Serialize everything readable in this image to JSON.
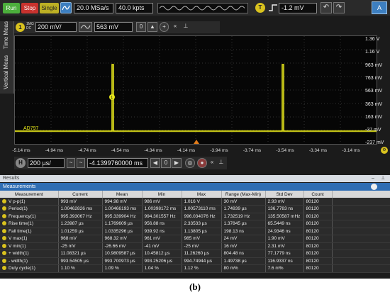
{
  "toolbar": {
    "run_label": "Run",
    "stop_label": "Stop",
    "single_label": "Single",
    "sample_rate": "20.0 MSa/s",
    "memory_depth": "40.0 kpts",
    "trigger_badge": "T",
    "trigger_level": "-1.2 mV",
    "undo_label": "↶",
    "redo_label": "↷",
    "autoscale_label": "A"
  },
  "side_tabs": {
    "time_meas": "Time Meas",
    "vertical_meas": "Vertical Meas"
  },
  "channel": {
    "badge": "1",
    "coupling_top": "1MΩ",
    "coupling_bottom": "DC",
    "scale": "200 mV/",
    "offset": "563 mV"
  },
  "waveform": {
    "marker_label": "AD797",
    "marker_badge": "1",
    "volt_labels": [
      "1.36 V",
      "1.16 V",
      "963 mV",
      "763 mV",
      "563 mV",
      "363 mV",
      "163 mV",
      "-37 mV",
      "-237 mV"
    ],
    "time_labels": [
      "-5.14 ms",
      "-4.94 ms",
      "-4.74 ms",
      "-4.54 ms",
      "-4.34 ms",
      "-4.14 ms",
      "-3.94 ms",
      "-3.74 ms",
      "-3.54 ms",
      "-3.34 ms",
      "-3.14 ms"
    ],
    "trace_color": "#e5e51a"
  },
  "horizontal": {
    "badge": "H",
    "time_scale": "200 µs/",
    "delay": "-4.1399760000 ms"
  },
  "results": {
    "title": "Results",
    "measurements_title": "Measurements",
    "columns": [
      "Measurement",
      "Current",
      "Mean",
      "Min",
      "Max",
      "Range (Max-Min)",
      "Std Dev",
      "Count"
    ],
    "rows": [
      [
        "V p-p(1)",
        "993 mV",
        "994.98 mV",
        "986 mV",
        "1.016 V",
        "30 mV",
        "2.93 mV",
        "80120"
      ],
      [
        "Period(1)",
        "1.00462826 ms",
        "1.00466193 ms",
        "1.00398172 ms",
        "1.00573110 ms",
        "1.74939 µs",
        "136.7783 ns",
        "80120"
      ],
      [
        "Frequency(1)",
        "995.393067 Hz",
        "995.339904 Hz",
        "994.301557 Hz",
        "996.034076 Hz",
        "1.732519 Hz",
        "135.50587 mHz",
        "80120"
      ],
      [
        "Rise time(1)",
        "1.23987 µs",
        "1.1769609 µs",
        "956.88 ns",
        "2.33533 µs",
        "1.37845 µs",
        "65.5449 ns",
        "80120"
      ],
      [
        "Fall time(1)",
        "1.01259 µs",
        "1.0335296 µs",
        "939.92 ns",
        "1.13805 µs",
        "198.13 ns",
        "24.9346 ns",
        "80120"
      ],
      [
        "V max(1)",
        "968 mV",
        "968.32 mV",
        "961 mV",
        "985 mV",
        "24 mV",
        "1.90 mV",
        "80120"
      ],
      [
        "V min(1)",
        "-25 mV",
        "-26.66 mV",
        "-41 mV",
        "-25 mV",
        "16 mV",
        "2.31 mV",
        "80120"
      ],
      [
        "+ width(1)",
        "11.08321 µs",
        "10.9809587 µs",
        "10.45812 µs",
        "11.26260 µs",
        "804.48 ns",
        "77.1779 ns",
        "80120"
      ],
      [
        "- width(1)",
        "993.54505 µs",
        "993.700973 µs",
        "993.25206 µs",
        "994.74944 µs",
        "1.49738 µs",
        "116.9337 ns",
        "80120"
      ],
      [
        "Duty cycle(1)",
        "1.10 %",
        "1.09 %",
        "1.04 %",
        "1.12 %",
        "80 m%",
        "7.6 m%",
        "80120"
      ]
    ]
  },
  "caption": "(b)"
}
